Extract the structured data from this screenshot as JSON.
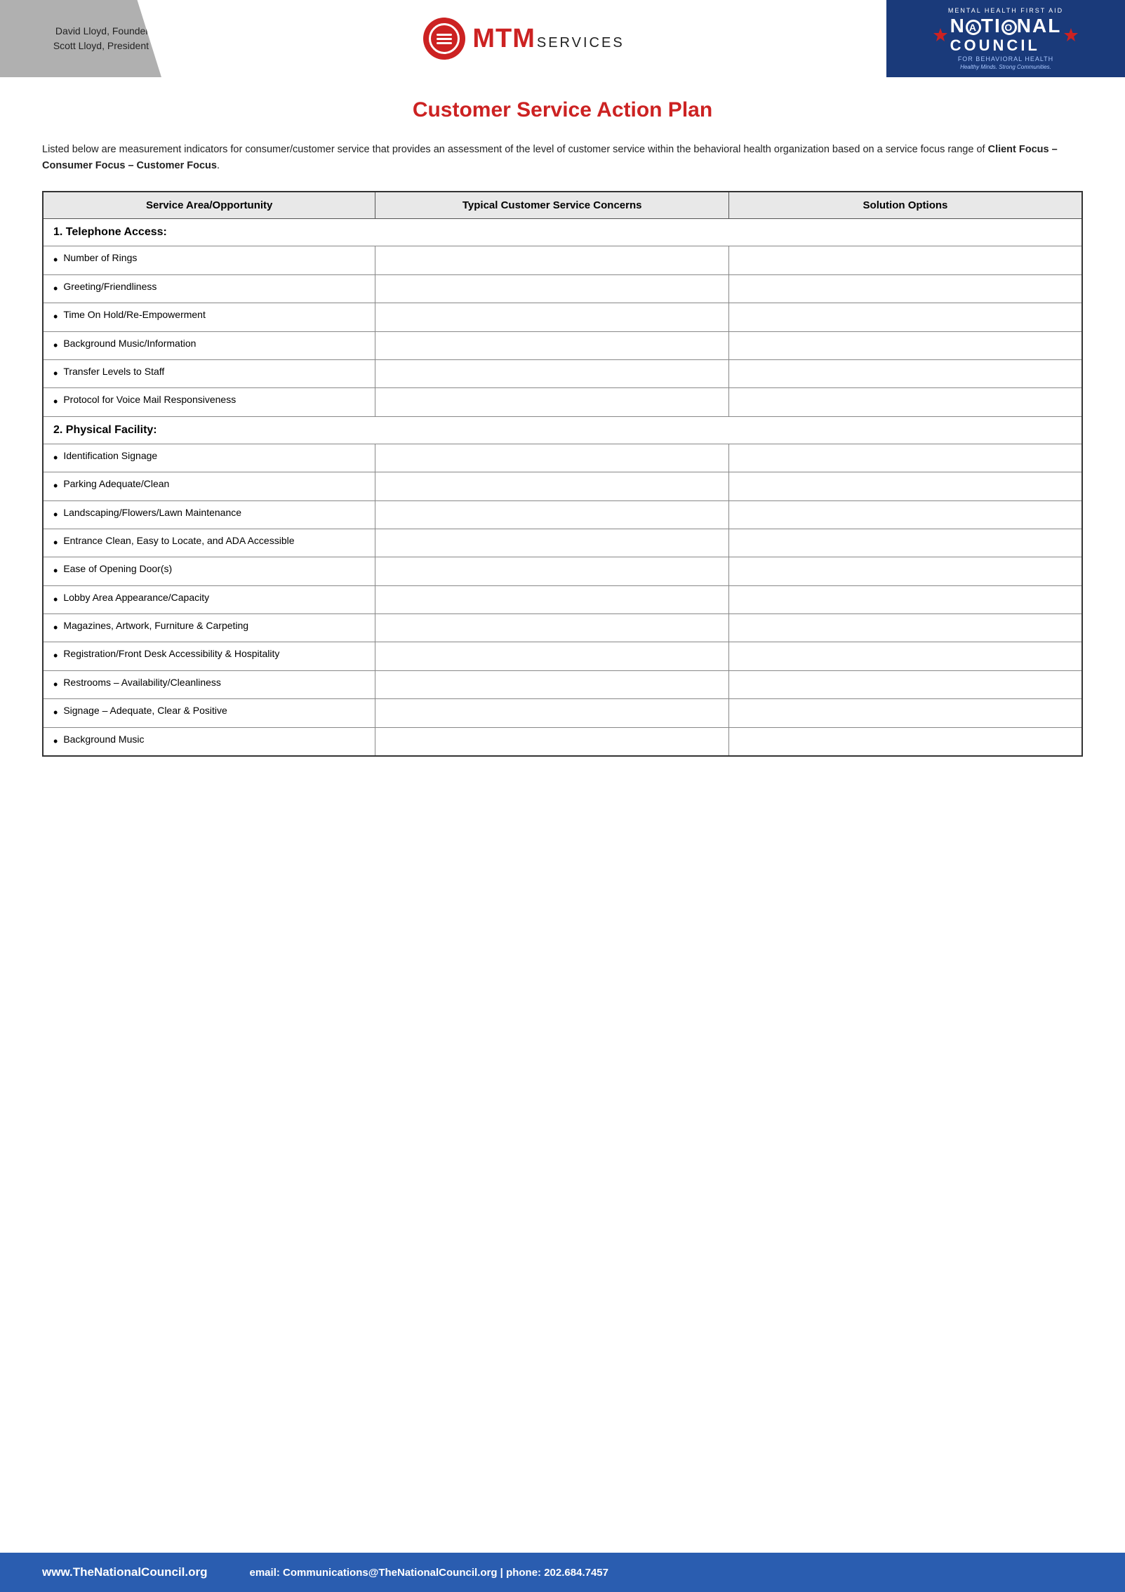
{
  "header": {
    "founder": "David Lloyd, Founder",
    "president": "Scott Lloyd, President",
    "logo_mtm": "MTM",
    "logo_services": "SERVICES",
    "nc_top": "MENTAL HEALTH FIRST AID",
    "nc_national": "NATIONAL",
    "nc_council": "COUNCIL",
    "nc_sub": "FOR BEHAVIORAL HEALTH",
    "nc_tagline": "Healthy Minds. Strong Communities."
  },
  "page": {
    "title": "Customer Service Action Plan",
    "intro": "Listed below are measurement indicators for consumer/customer service that provides an assessment of the level of customer service within the behavioral health organization based on a service focus range of ",
    "intro_bold": "Client Focus – Consumer Focus – Customer Focus",
    "intro_end": "."
  },
  "table": {
    "col1_header": "Service Area/Opportunity",
    "col2_header": "Typical Customer Service Concerns",
    "col3_header": "Solution Options",
    "sections": [
      {
        "type": "section",
        "label": "1.  Telephone Access:"
      },
      {
        "type": "row",
        "item": "Number of Rings"
      },
      {
        "type": "row",
        "item": "Greeting/Friendliness"
      },
      {
        "type": "row",
        "item": "Time On Hold/Re-Empowerment"
      },
      {
        "type": "row",
        "item": "Background Music/Information"
      },
      {
        "type": "row",
        "item": "Transfer Levels to Staff"
      },
      {
        "type": "row",
        "item": "Protocol for Voice Mail Responsiveness",
        "multiline": true
      },
      {
        "type": "section",
        "label": "2.  Physical Facility:"
      },
      {
        "type": "row",
        "item": "Identification Signage"
      },
      {
        "type": "row",
        "item": "Parking Adequate/Clean"
      },
      {
        "type": "row",
        "item": "Landscaping/Flowers/Lawn Maintenance",
        "multiline": true
      },
      {
        "type": "row",
        "item": "Entrance Clean, Easy to Locate, and ADA Accessible",
        "multiline": true
      },
      {
        "type": "row",
        "item": "Ease of Opening Door(s)"
      },
      {
        "type": "row",
        "item": "Lobby Area Appearance/Capacity"
      },
      {
        "type": "row",
        "item": "Magazines, Artwork, Furniture & Carpeting",
        "multiline": true
      },
      {
        "type": "row",
        "item": "Registration/Front Desk Accessibility & Hospitality",
        "multiline": true
      },
      {
        "type": "row",
        "item": "Restrooms – Availability/Cleanliness"
      },
      {
        "type": "row",
        "item": "Signage – Adequate, Clear & Positive"
      },
      {
        "type": "row",
        "item": "Background Music"
      }
    ]
  },
  "footer": {
    "website_prefix": "www.",
    "website_bold": "TheNationalCouncil",
    "website_suffix": ".org",
    "email_label": "email: ",
    "email_bold": "Communications@TheNationalCouncil.org",
    "separator": " | ",
    "phone_label": "phone: ",
    "phone_bold": "202.684.7457"
  }
}
